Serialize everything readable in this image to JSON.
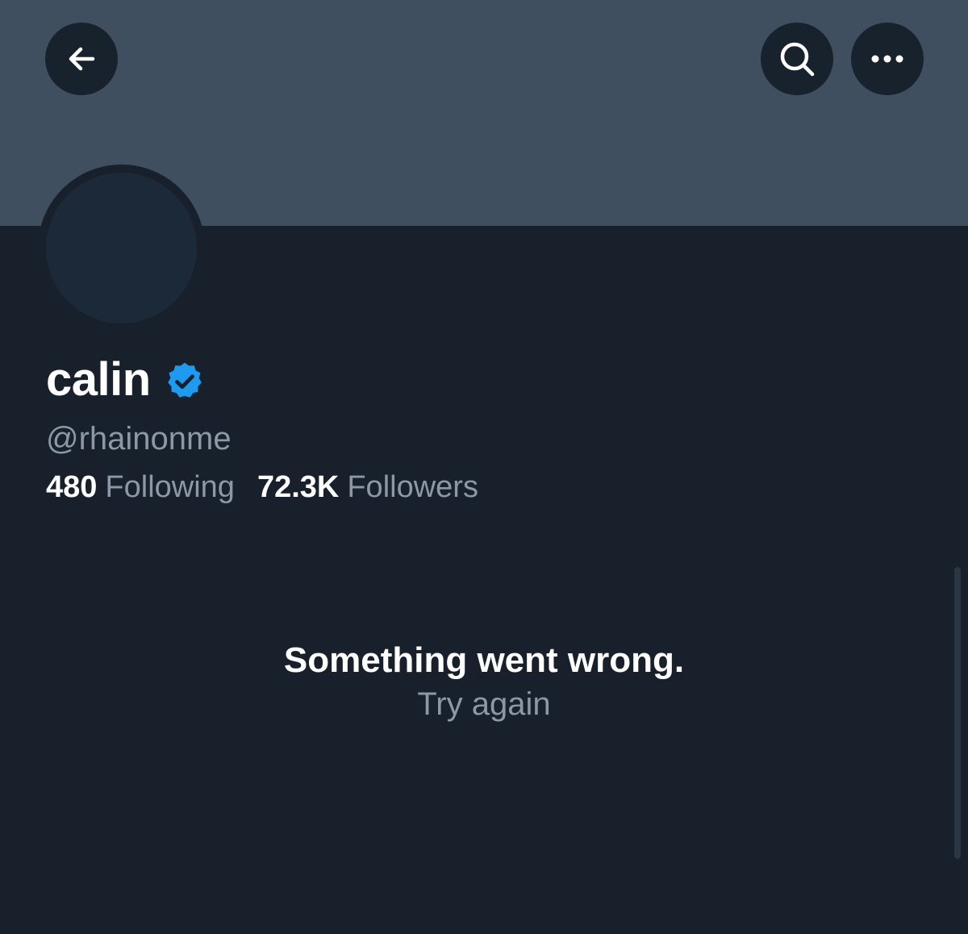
{
  "header": {
    "back_icon": "arrow-left-icon",
    "search_icon": "search-icon",
    "more_icon": "more-horizontal-icon",
    "banner_color": "#3f4f5f"
  },
  "profile": {
    "display_name": "calin",
    "verified_icon": "verified-badge-icon",
    "verified_color": "#1d9bf0",
    "handle": "@rhainonme",
    "following_count": "480",
    "following_label": "Following",
    "followers_count": "72.3K",
    "followers_label": "Followers"
  },
  "error": {
    "title": "Something went wrong.",
    "retry_label": "Try again"
  }
}
